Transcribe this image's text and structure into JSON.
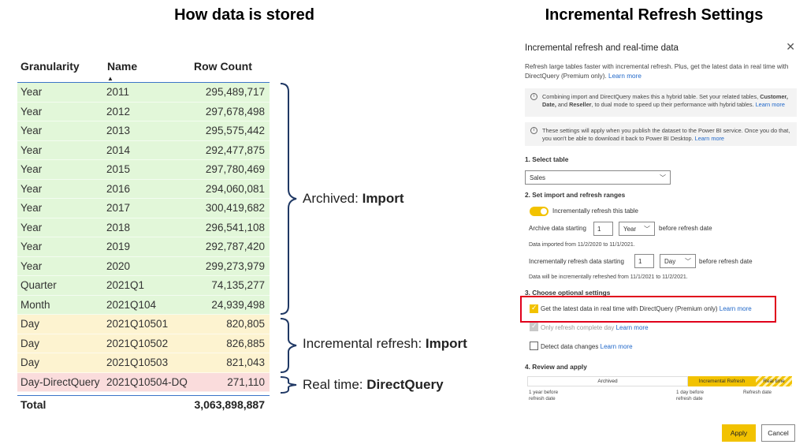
{
  "headings": {
    "left": "How data is stored",
    "right": "Incremental Refresh Settings"
  },
  "table": {
    "columns": {
      "granularity": "Granularity",
      "name": "Name",
      "row_count": "Row Count"
    },
    "sort_indicator": "▲",
    "rows": [
      {
        "granularity": "Year",
        "name": "2011",
        "row_count": "295,489,717",
        "group": "archived"
      },
      {
        "granularity": "Year",
        "name": "2012",
        "row_count": "297,678,498",
        "group": "archived"
      },
      {
        "granularity": "Year",
        "name": "2013",
        "row_count": "295,575,442",
        "group": "archived"
      },
      {
        "granularity": "Year",
        "name": "2014",
        "row_count": "292,477,875",
        "group": "archived"
      },
      {
        "granularity": "Year",
        "name": "2015",
        "row_count": "297,780,469",
        "group": "archived"
      },
      {
        "granularity": "Year",
        "name": "2016",
        "row_count": "294,060,081",
        "group": "archived"
      },
      {
        "granularity": "Year",
        "name": "2017",
        "row_count": "300,419,682",
        "group": "archived"
      },
      {
        "granularity": "Year",
        "name": "2018",
        "row_count": "296,541,108",
        "group": "archived"
      },
      {
        "granularity": "Year",
        "name": "2019",
        "row_count": "292,787,420",
        "group": "archived"
      },
      {
        "granularity": "Year",
        "name": "2020",
        "row_count": "299,273,979",
        "group": "archived"
      },
      {
        "granularity": "Quarter",
        "name": "2021Q1",
        "row_count": "74,135,277",
        "group": "archived"
      },
      {
        "granularity": "Month",
        "name": "2021Q104",
        "row_count": "24,939,498",
        "group": "archived"
      },
      {
        "granularity": "Day",
        "name": "2021Q10501",
        "row_count": "820,805",
        "group": "incremental"
      },
      {
        "granularity": "Day",
        "name": "2021Q10502",
        "row_count": "826,885",
        "group": "incremental"
      },
      {
        "granularity": "Day",
        "name": "2021Q10503",
        "row_count": "821,043",
        "group": "incremental"
      },
      {
        "granularity": "Day-DirectQuery",
        "name": "2021Q10504-DQ",
        "row_count": "271,110",
        "group": "realtime"
      }
    ],
    "total_label": "Total",
    "total_value": "3,063,898,887"
  },
  "braces": {
    "archived": {
      "prefix": "Archived: ",
      "mode": "Import"
    },
    "incremental": {
      "prefix": "Incremental refresh: ",
      "mode": "Import"
    },
    "realtime": {
      "prefix": "Real time: ",
      "mode": "DirectQuery"
    }
  },
  "dialog": {
    "title": "Incremental refresh and real-time data",
    "close_icon": "✕",
    "description": "Refresh large tables faster with incremental refresh. Plus, get the latest data in real time with DirectQuery (Premium only).",
    "learn_more": "Learn more",
    "info1": {
      "text1": "Combining import and DirectQuery makes this a hybrid table. Set your related tables,",
      "bold1": "Customer, Date,",
      "text2": " and ",
      "bold2": "Reseller",
      "text3": ", to dual mode to speed up their performance with hybrid tables."
    },
    "info2": "These settings will apply when you publish the dataset to the Power BI service. Once you do that, you won't be able to download it back to Power BI Desktop.",
    "section1": "1. Select table",
    "table_select": "Sales",
    "section2": "2. Set import and refresh ranges",
    "toggle_label": "Incrementally refresh this table",
    "archive": {
      "label": "Archive data starting",
      "value": "1",
      "unit": "Year",
      "after": "before refresh date",
      "note": "Data imported from 11/2/2020 to 11/1/2021."
    },
    "incremental": {
      "label": "Incrementally refresh data starting",
      "value": "1",
      "unit": "Day",
      "after": "before refresh date",
      "note": "Data will be incrementally refreshed from 11/1/2021 to 11/2/2021."
    },
    "section3": "3. Choose optional settings",
    "opt_realtime": "Get the latest data in real time with DirectQuery (Premium only)",
    "opt_complete": "Only refresh complete day",
    "opt_detect": "Detect data changes",
    "section4": "4. Review and apply",
    "timeline": {
      "archived": "Archived",
      "incremental": "Incremental Refresh",
      "realtime": "Real time",
      "cap1": "1 year before\nrefresh date",
      "cap2": "1 day before\nrefresh date",
      "cap3": "Refresh date"
    },
    "apply": "Apply",
    "cancel": "Cancel"
  },
  "colors": {
    "archived_row": "#e2f7d9",
    "incremental_row": "#fdf3d0",
    "realtime_row": "#fadcdc",
    "accent_yellow": "#f2c200",
    "highlight_red": "#e0001b",
    "link_blue": "#2168c9"
  }
}
